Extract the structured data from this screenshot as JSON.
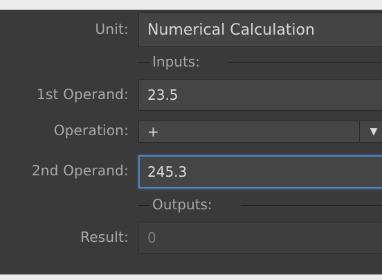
{
  "form": {
    "unit_label": "Unit:",
    "unit_value": "Numerical Calculation",
    "inputs_section": "Inputs:",
    "operand1_label": "1st Operand:",
    "operand1_value": "23.5",
    "operation_label": "Operation:",
    "operation_value": "+",
    "operand2_label": "2nd Operand:",
    "operand2_value": "245.3",
    "outputs_section": "Outputs:",
    "result_label": "Result:",
    "result_value": "0"
  },
  "icons": {
    "dropdown": "chevron-down-icon"
  },
  "colors": {
    "background": "#3a3a3a",
    "focus_border": "#4d87c3",
    "label_text": "#a9a9a9",
    "field_text": "#dcdcdc"
  }
}
